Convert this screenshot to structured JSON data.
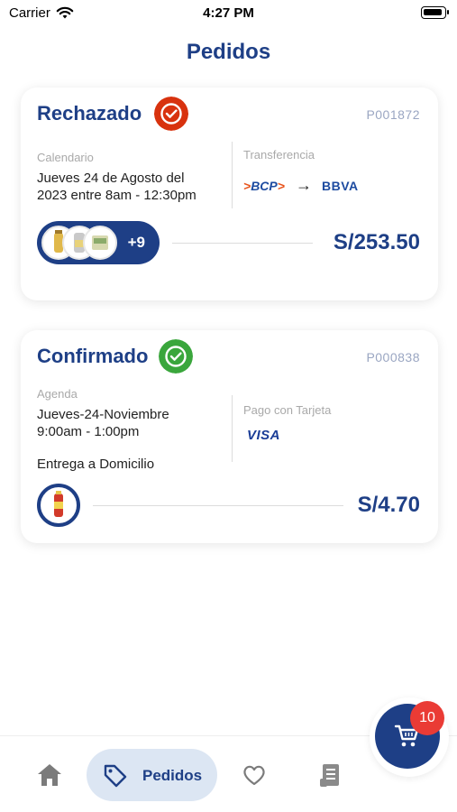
{
  "status_bar": {
    "carrier": "Carrier",
    "time": "4:27 PM"
  },
  "page": {
    "title": "Pedidos"
  },
  "orders": [
    {
      "status": "Rechazado",
      "status_color": "#d8320e",
      "status_icon": "check-circle-icon",
      "order_id": "P001872",
      "schedule_label": "Calendario",
      "schedule_line1": "Jueves 24 de Agosto del",
      "schedule_line2": "2023 entre 8am - 12:30pm",
      "payment_label": "Transferencia",
      "payment_from": "BCP",
      "payment_to": "BBVA",
      "extra_items": "+9",
      "amount": "S/253.50"
    },
    {
      "status": "Confirmado",
      "status_color": "#3aa63c",
      "status_icon": "check-circle-icon",
      "order_id": "P000838",
      "schedule_label": "Agenda",
      "schedule_line1": "Jueves-24-Noviembre",
      "schedule_line2": "9:00am - 1:00pm",
      "payment_label": "Pago con Tarjeta",
      "payment_brand": "VISA",
      "delivery": "Entrega a Domicilio",
      "amount": "S/4.70"
    }
  ],
  "bottom_nav": {
    "items": [
      {
        "icon": "home-icon"
      },
      {
        "icon": "tag-icon",
        "label": "Pedidos"
      },
      {
        "icon": "heart-icon"
      },
      {
        "icon": "receipt-icon"
      }
    ],
    "active_color": "#1e3f86"
  },
  "cart": {
    "icon": "cart-icon",
    "count": "10"
  }
}
